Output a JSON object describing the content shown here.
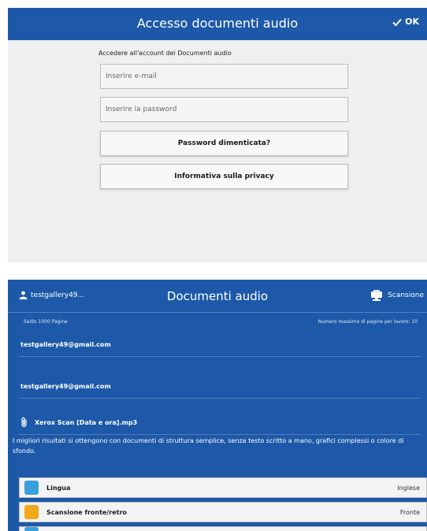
{
  "login_dialog": {
    "title": "Accesso documenti audio",
    "ok_label": "OK",
    "prompt": "Accedere all'account dei Documenti audio",
    "email_placeholder": "Inserire e-mail",
    "password_placeholder": "Inserire la password",
    "forgot_password_label": "Password dimenticata?",
    "privacy_label": "Informativa sulla privacy"
  },
  "audio_app": {
    "title": "Documenti audio",
    "username": "testgallery49...",
    "scan_label": "Scansione",
    "balance": "Saldo 1000 Pagine",
    "max_pages": "Numero massimo di pagine per lavoro: 10",
    "email_from": "testgallery49@gmail.com",
    "email_to": "testgallery49@gmail.com",
    "filename": "Xerox Scan [Data e ora].mp3",
    "note": "I migliori risultati si ottengono con documenti di struttura semplice, senza testo scritto a mano, grafici complessi o colore di sfondo.",
    "options": [
      {
        "label": "Lingua",
        "value": "Inglese"
      },
      {
        "label": "Scansione fronte/retro",
        "value": "Fronte"
      }
    ]
  },
  "colors": {
    "header_blue": "#1d59a8",
    "panel_gray": "#efefef",
    "language_icon": "#3aa0dc",
    "duplex_icon": "#f2a81d"
  }
}
